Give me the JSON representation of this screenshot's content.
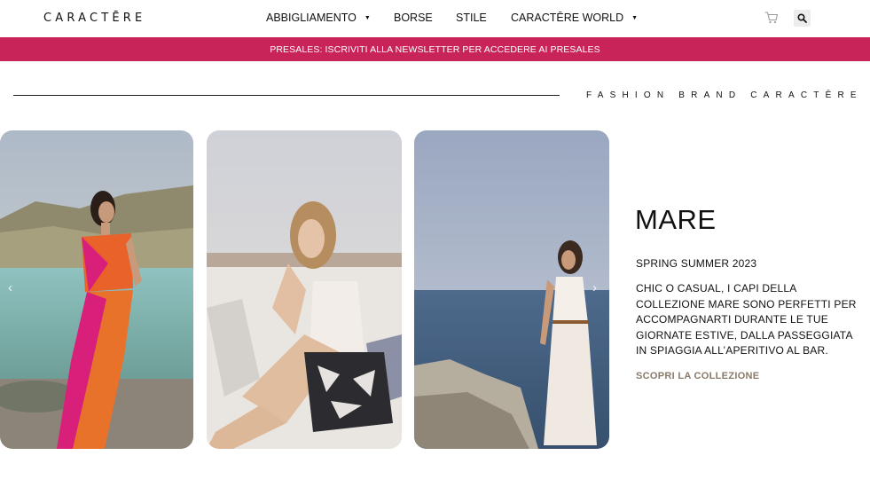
{
  "header": {
    "logo": "CARACTĒRE",
    "nav": [
      {
        "label": "ABBIGLIAMENTO",
        "has_dropdown": true
      },
      {
        "label": "BORSE",
        "has_dropdown": false
      },
      {
        "label": "STILE",
        "has_dropdown": false
      },
      {
        "label": "CARACTĒRE WORLD",
        "has_dropdown": true
      }
    ],
    "icons": [
      "cart-icon",
      "search-icon"
    ]
  },
  "banner": {
    "text": "PRESALES: ISCRIVITI ALLA NEWSLETTER PER ACCEDERE AI PRESALES",
    "color": "#c8245a"
  },
  "section": {
    "tagline": "FASHION BRAND CARACTĒRE"
  },
  "gallery": {
    "images": [
      "photo-woman-seaside-orange-dress",
      "photo-woman-sitting-terrace",
      "photo-woman-white-dress-sea"
    ]
  },
  "collection": {
    "title": "MARE",
    "season": "SPRING SUMMER 2023",
    "description": "CHIC O CASUAL, I CAPI DELLA COLLEZIONE MARE SONO PERFETTI PER ACCOMPAGNARTI DURANTE LE TUE GIORNATE ESTIVE, DALLA PASSEGGIATA IN SPIAGGIA ALL’APERITIVO AL BAR.",
    "cta": "SCOPRI LA COLLEZIONE",
    "cta_color": "#8a7a6a"
  }
}
